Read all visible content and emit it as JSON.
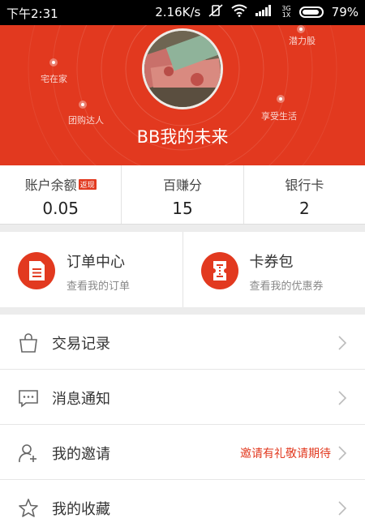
{
  "status_bar": {
    "time": "下午2:31",
    "net_speed": "2.16K/s",
    "network_top": "3G",
    "network_bottom": "1X",
    "battery": "79%"
  },
  "profile": {
    "username": "BB我的未来",
    "floating_tags": [
      "潜力股",
      "宅在家",
      "团购达人",
      "享受生活"
    ]
  },
  "stats": [
    {
      "label": "账户余额",
      "badge": "返现",
      "value": "0.05"
    },
    {
      "label": "百赚分",
      "value": "15"
    },
    {
      "label": "银行卡",
      "value": "2"
    }
  ],
  "quick_cards": [
    {
      "title": "订单中心",
      "subtitle": "查看我的订单",
      "icon": "document-icon"
    },
    {
      "title": "卡券包",
      "subtitle": "查看我的优惠券",
      "icon": "ticket-icon"
    }
  ],
  "menu": [
    {
      "label": "交易记录",
      "icon": "shopping-bag-icon",
      "extra": ""
    },
    {
      "label": "消息通知",
      "icon": "chat-bubble-icon",
      "extra": ""
    },
    {
      "label": "我的邀请",
      "icon": "add-user-icon",
      "extra": "邀请有礼敬请期待"
    },
    {
      "label": "我的收藏",
      "icon": "star-icon",
      "extra": ""
    }
  ],
  "colors": {
    "accent": "#e2391f",
    "statusbar": "#000000",
    "background": "#ececec"
  }
}
